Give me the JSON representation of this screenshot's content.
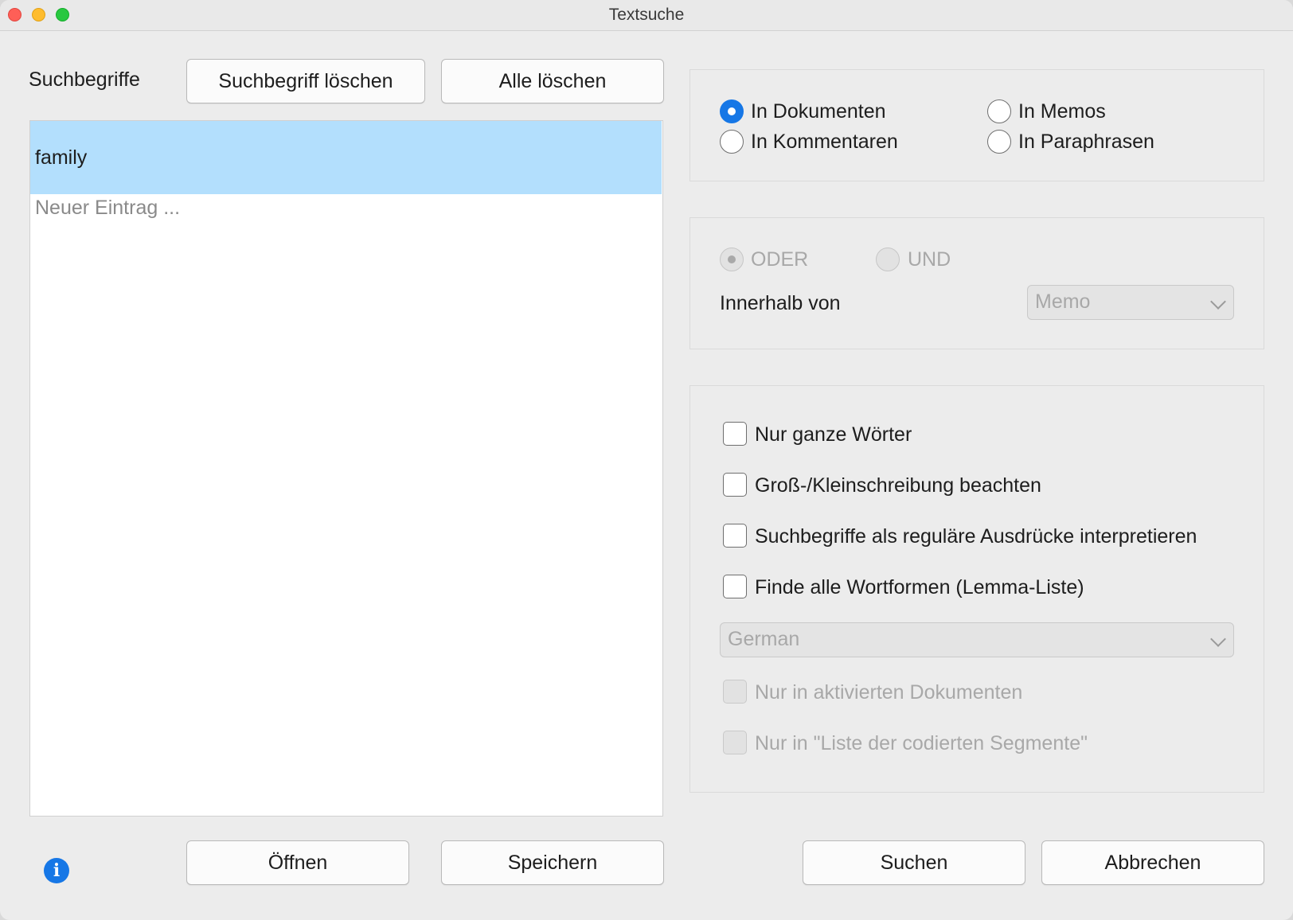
{
  "window": {
    "title": "Textsuche"
  },
  "search_terms": {
    "label": "Suchbegriffe",
    "delete_term_label": "Suchbegriff löschen",
    "delete_all_label": "Alle löschen",
    "items": [
      "family"
    ],
    "new_entry_placeholder": "Neuer Eintrag ..."
  },
  "scope": {
    "options": [
      {
        "label": "In Dokumenten",
        "checked": true
      },
      {
        "label": "In Memos",
        "checked": false
      },
      {
        "label": "In Kommentaren",
        "checked": false
      },
      {
        "label": "In Paraphrasen",
        "checked": false
      }
    ]
  },
  "logic": {
    "or_label": "ODER",
    "and_label": "UND",
    "selected": "ODER",
    "within_label": "Innerhalb von",
    "within_value": "Memo"
  },
  "options": {
    "whole_words": "Nur ganze Wörter",
    "case_sensitive": "Groß-/Kleinschreibung beachten",
    "regex": "Suchbegriffe als reguläre Ausdrücke interpretieren",
    "lemma": "Finde alle Wortformen (Lemma-Liste)",
    "language_value": "German",
    "only_activated": "Nur in aktivierten Dokumenten",
    "only_coded_segments": "Nur in \"Liste der codierten Segmente\""
  },
  "footer": {
    "open_label": "Öffnen",
    "save_label": "Speichern",
    "search_label": "Suchen",
    "cancel_label": "Abbrechen",
    "accent_color": "#1677e6"
  }
}
